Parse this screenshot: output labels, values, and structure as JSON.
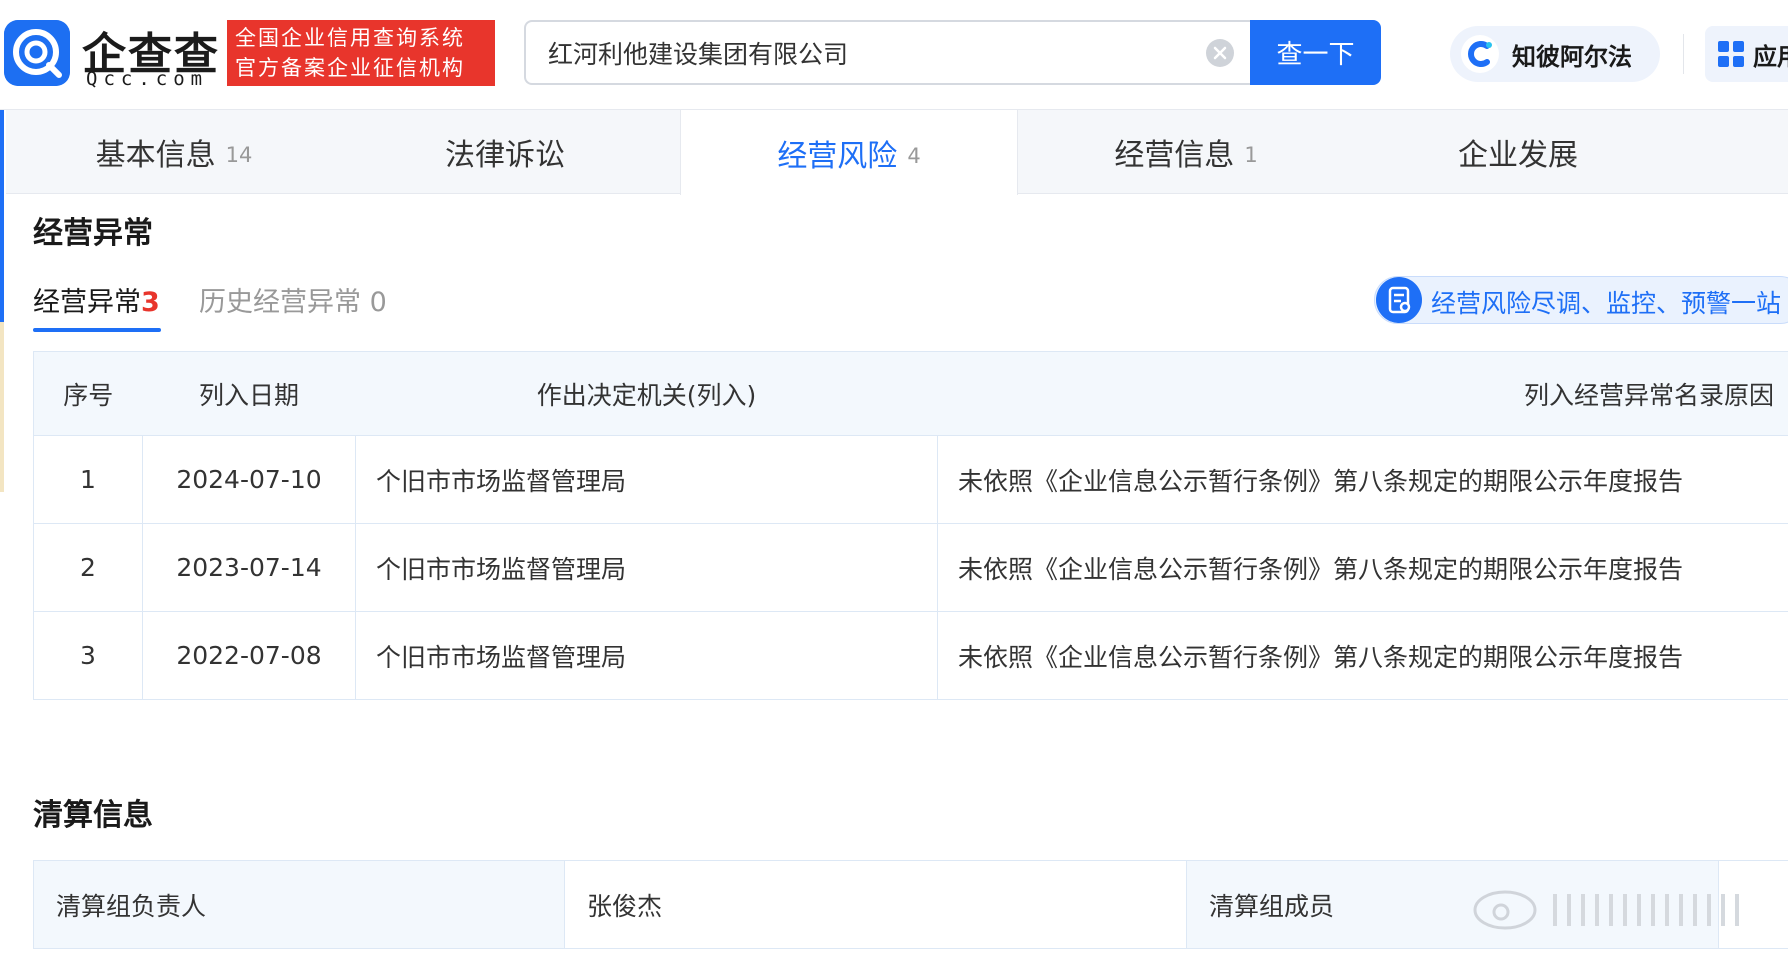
{
  "header": {
    "logo_cn": "企查查",
    "logo_en": "Qcc.com",
    "cert_line1": "全国企业信用查询系统",
    "cert_line2": "官方备案企业征信机构",
    "search_value": "红河利他建设集团有限公司",
    "search_button": "查一下",
    "ai_label": "知彼阿尔法",
    "app_label": "应用",
    "brand_color": "#1e6ff6",
    "cert_color": "#e8352c"
  },
  "tabs": [
    {
      "label": "基本信息",
      "count": "14"
    },
    {
      "label": "法律诉讼",
      "count": ""
    },
    {
      "label": "经营风险",
      "count": "4"
    },
    {
      "label": "经营信息",
      "count": "1"
    },
    {
      "label": "企业发展",
      "count": ""
    }
  ],
  "abnormal": {
    "title": "经营异常",
    "subtab_active_label": "经营异常",
    "subtab_active_count": "3",
    "subtab_history": "历史经营异常 0",
    "promo": "经营风险尽调、监控、预警一站",
    "columns": [
      "序号",
      "列入日期",
      "作出决定机关(列入)",
      "列入经营异常名录原因"
    ],
    "rows": [
      {
        "no": "1",
        "date": "2024-07-10",
        "authority": "个旧市市场监督管理局",
        "reason": "未依照《企业信息公示暂行条例》第八条规定的期限公示年度报告"
      },
      {
        "no": "2",
        "date": "2023-07-14",
        "authority": "个旧市市场监督管理局",
        "reason": "未依照《企业信息公示暂行条例》第八条规定的期限公示年度报告"
      },
      {
        "no": "3",
        "date": "2022-07-08",
        "authority": "个旧市市场监督管理局",
        "reason": "未依照《企业信息公示暂行条例》第八条规定的期限公示年度报告"
      }
    ]
  },
  "liquidation": {
    "title": "清算信息",
    "leader_label": "清算组负责人",
    "leader_value": "张俊杰",
    "members_label": "清算组成员",
    "members_value": ""
  },
  "icons": {
    "logo": "qcc-logo-icon",
    "clear": "clear-circle-icon",
    "ai": "alpha-ai-icon",
    "app": "app-grid-icon",
    "promo": "report-shield-icon"
  }
}
